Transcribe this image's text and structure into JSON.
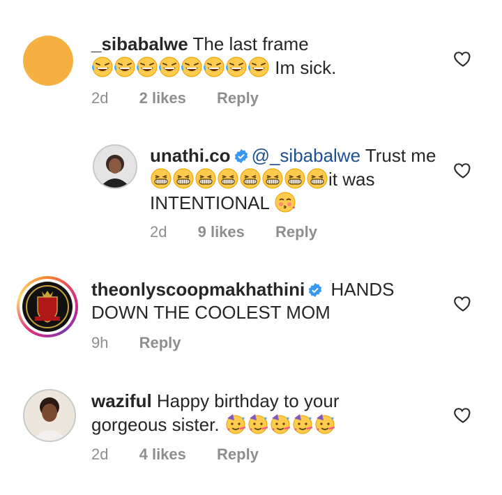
{
  "comments": [
    {
      "username": "_sibabalwe",
      "text_before": "The last frame",
      "emoji_name": "rolling-on-floor-laughing",
      "emoji_count": 8,
      "text_after": "Im sick.",
      "time": "2d",
      "likes": "2 likes",
      "reply": "Reply",
      "avatar_color": "#f6b042"
    },
    {
      "username": "unathi.co",
      "verified": true,
      "mention": "@_sibabalwe",
      "text_before": "Trust me",
      "emoji_name": "grinning-squinting-face",
      "emoji_count": 8,
      "text_after": "it was",
      "text_line3": "INTENTIONAL",
      "trailing_emoji": "face-blowing-kiss",
      "time": "2d",
      "likes": "9 likes",
      "reply": "Reply"
    },
    {
      "username": "theonlyscoopmakhathini",
      "verified": true,
      "text": "HANDS DOWN THE COOLEST MOM",
      "text_line1": "HANDS",
      "text_line2": "DOWN THE COOLEST MOM",
      "time": "9h",
      "reply": "Reply"
    },
    {
      "username": "waziful",
      "text_before": "Happy birthday to your",
      "text_line2": "gorgeous sister.",
      "emoji_name": "partying-face",
      "emoji_count": 5,
      "time": "2d",
      "likes": "4 likes",
      "reply": "Reply"
    }
  ],
  "colors": {
    "verified": "#3897f0",
    "meta": "#8e8e8e",
    "mention": "#1d4f91",
    "emoji_yellow": "#ffcb4c"
  }
}
